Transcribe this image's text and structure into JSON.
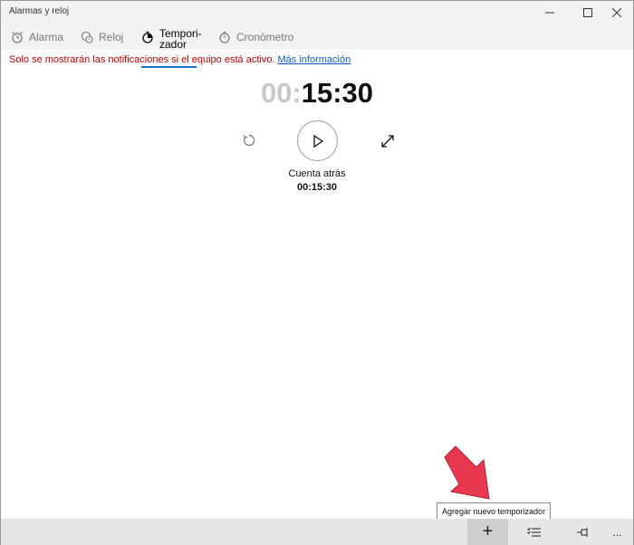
{
  "window": {
    "title": "Alarmas y reloj"
  },
  "tabs": [
    {
      "label": "Alarma",
      "icon": "alarm-clock-icon"
    },
    {
      "label": "Reloj",
      "icon": "world-clock-icon"
    },
    {
      "label_line1": "Tempori-",
      "label_line2": "zador",
      "icon": "timer-icon"
    },
    {
      "label": "Cronómetro",
      "icon": "stopwatch-icon"
    }
  ],
  "notice": {
    "text": "Solo se mostrarán las notificaciones si el equipo está activo.",
    "link": "Más información"
  },
  "timer": {
    "hours": "00",
    "sep1": ":",
    "rest": "15:30",
    "name": "Cuenta atrás",
    "value": "00:15:30"
  },
  "command_bar": {
    "add_glyph": "+",
    "more_glyph": "..."
  },
  "tooltip": {
    "text": "Agregar nuevo temporizador"
  },
  "colors": {
    "accent": "#1a6fc9",
    "notice_red": "#c50000",
    "link_blue": "#0b5fc0",
    "arrow_red": "#e8384f"
  }
}
